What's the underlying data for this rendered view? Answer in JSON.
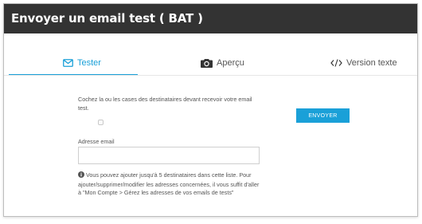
{
  "modal": {
    "title": "Envoyer un email test ( BAT )"
  },
  "tabs": [
    {
      "label": "Tester",
      "icon": "envelope-icon",
      "active": true
    },
    {
      "label": "Aperçu",
      "icon": "camera-icon",
      "active": false
    },
    {
      "label": "Version texte",
      "icon": "code-icon",
      "active": false
    }
  ],
  "form": {
    "instructions": "Cochez la ou les cases des destinataires devant recevoir votre email test.",
    "recipient_checkbox_checked": false,
    "email_label": "Adresse email",
    "email_value": "",
    "email_placeholder": "",
    "help_text": "Vous pouvez ajouter jusqu'à 5 destinataires dans cette liste. Pour ajouter/supprimer/modifier les adresses concernées, il vous suffit d'aller à \"Mon Compte > Gérez les adresses de vos emails de tests\"",
    "help_icon": "info-circle-icon"
  },
  "actions": {
    "send_label": "ENVOYER"
  },
  "colors": {
    "header_bg": "#333333",
    "accent": "#1aa0d8"
  }
}
